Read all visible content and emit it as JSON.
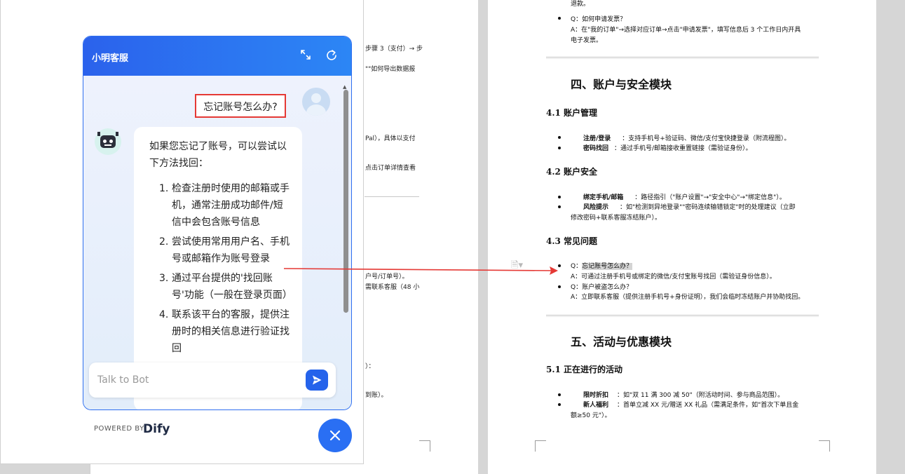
{
  "document_left": {
    "snippets": [
      "步骤 3（支付）→ 步",
      "\"\"如何导出数据报",
      "Pal），具体以支付",
      "点击订单详情查看",
      "户号/订单号）。",
      "需联系客服（48 小",
      "）：",
      "到账）。"
    ]
  },
  "document_right": {
    "top_lines": [
      "退款。",
      "如何申请发票？",
      "在\"我的订单\"→选择对应订单→点击\"申请发票\"，填写信息后 3 个工作日内开具",
      "电子发票。"
    ],
    "q_label": "Q：",
    "a_label": "A：",
    "section4_title": "四、账户与安全模块",
    "s41_title": "4.1 账户管理",
    "s41_items": [
      {
        "label": "注册/登录",
        "text": "：支持手机号+验证码、微信/支付宝快捷登录（附流程图）。"
      },
      {
        "label": "密码找回",
        "text": "：通过手机号/邮箱接收重置链接（需验证身份）。"
      }
    ],
    "s42_title": "4.2 账户安全",
    "s42_items": [
      {
        "label": "绑定手机/邮箱",
        "text": "：路径指引（\"账户设置\"→\"安全中心\"→\"绑定信息\"）。"
      },
      {
        "label": "风险提示",
        "text": "：如\"检测到异地登录\"\"密码连续输错锁定\"时的处理建议（立即"
      }
    ],
    "s42_item2_cont": "修改密码+联系客服冻结账户）。",
    "s43_title": "4.3 常见问题",
    "faq": [
      {
        "q": "忘记账号怎么办？",
        "a": "可通过注册手机号或绑定的微信/支付宝账号找回（需验证身份信息）。"
      },
      {
        "q": "账户被盗怎么办？",
        "a": "立即联系客服（提供注册手机号+身份证明），我们会临时冻结账户并协助找回。"
      }
    ],
    "section5_title": "五、活动与优惠模块",
    "s51_title": "5.1 正在进行的活动",
    "s51_items": [
      {
        "label": "限时折扣",
        "text": "：如\"双 11 满 300 减 50\"（附活动时间、参与商品范围）。"
      },
      {
        "label": "新人福利",
        "text": "：首单立减 XX 元/赠送 XX 礼品（需满足条件，如\"首次下单且金"
      }
    ],
    "s51_item2_cont": "额≥50 元\"）。"
  },
  "chat": {
    "title": "小明客服",
    "user_message": "忘记账号怎么办?",
    "bot_intro": "如果您忘记了账号，可以尝试以下方法找回：",
    "bot_steps": [
      "检查注册时使用的邮箱或手机，通常注册成功邮件/短信中会包含账号信息",
      "尝试使用常用用户名、手机号或邮箱作为账号登录",
      "通过平台提供的'找回账号'功能（一般在登录页面）",
      "联系该平台的客服，提供注册时的相关信息进行验证找回"
    ],
    "input_placeholder": "Talk to Bot",
    "powered_by": "POWERED BY",
    "brand": "Dify"
  },
  "colors": {
    "accent": "#2563eb",
    "highlight_box": "#e53935",
    "arrow": "#e53935"
  },
  "icons": [
    "expand-icon",
    "refresh-icon",
    "send-icon",
    "close-icon",
    "user-avatar-icon",
    "bot-avatar-icon",
    "document-icon"
  ]
}
